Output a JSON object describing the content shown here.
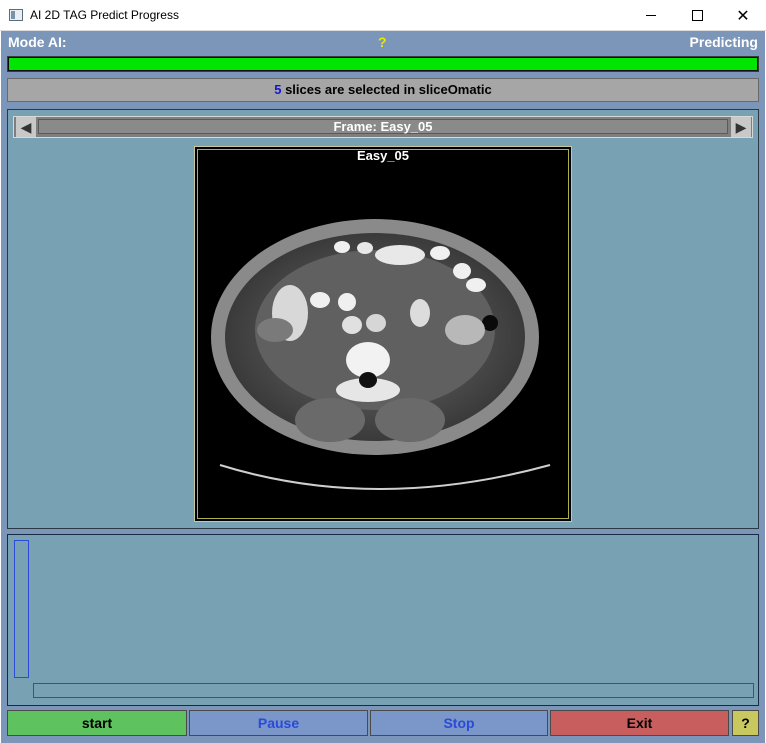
{
  "window": {
    "title": "AI 2D TAG Predict Progress",
    "minimize_glyph": "",
    "close_glyph": "✕"
  },
  "header": {
    "mode_label": "Mode AI:",
    "help_label": "?",
    "status": "Predicting"
  },
  "progress": {
    "fraction": 1.0,
    "color": "#00e600"
  },
  "info": {
    "count": "5",
    "text": " slices are selected in sliceOmatic"
  },
  "viewer": {
    "frame_title": "Frame: Easy_05",
    "image_label": "Easy_05",
    "prev_icon": "◀",
    "next_icon": "▶"
  },
  "buttons": {
    "start": "start",
    "pause": "Pause",
    "stop": "Stop",
    "exit": "Exit",
    "help": "?"
  }
}
